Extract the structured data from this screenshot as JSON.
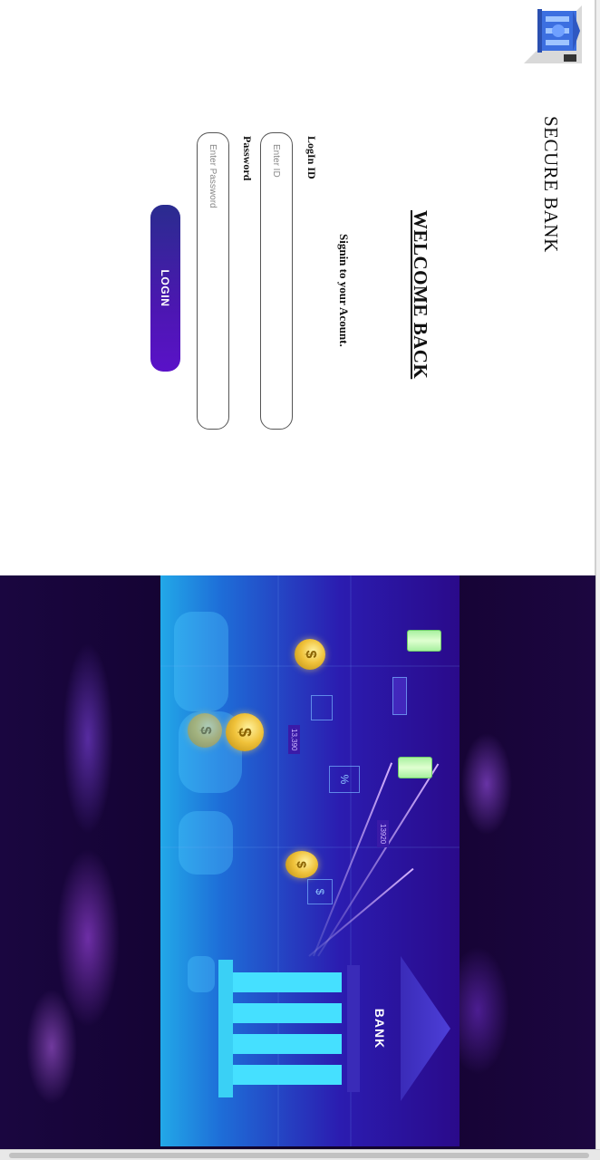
{
  "app": {
    "brand": "SECURE BANK",
    "logo_icon": "bank-building-icon"
  },
  "login": {
    "heading": "WELCOME BACK",
    "subtitle": "Signin to your Acount.",
    "login_id_label": "LogIn ID",
    "login_id_placeholder": "Enter ID",
    "login_id_value": "",
    "password_label": "Password",
    "password_placeholder": "Enter Password",
    "password_value": "",
    "button_label": "LOGIN"
  },
  "hero": {
    "bank_label": "BANK",
    "coin_symbol": "$",
    "percent_symbol": "%",
    "dollar_box_symbol": "$",
    "badge_1": "13,390",
    "badge_2": "13920"
  },
  "colors": {
    "accent": "#4b17b0",
    "hero_dark": "#10022a",
    "hero_card": "#2b1cb0",
    "pillar": "#49e8ff"
  }
}
